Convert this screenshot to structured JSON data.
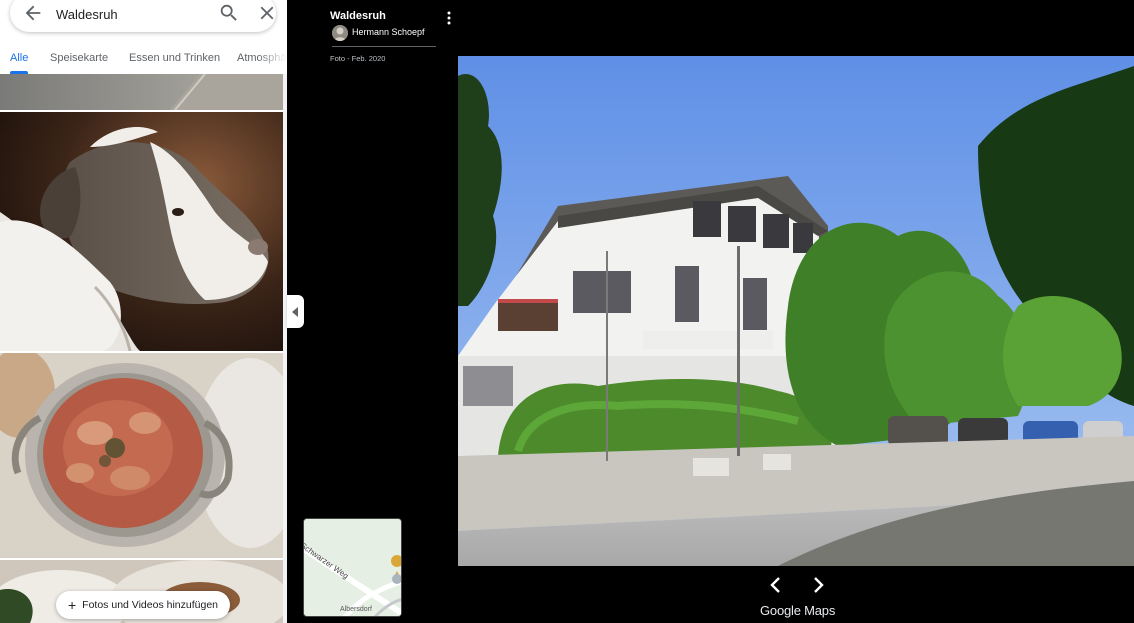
{
  "search": {
    "query": "Waldesruh"
  },
  "tabs": [
    {
      "label": "Alle",
      "active": true
    },
    {
      "label": "Speisekarte",
      "active": false
    },
    {
      "label": "Essen und Trinken",
      "active": false
    },
    {
      "label": "Atmosphäre",
      "active": false
    }
  ],
  "gallery": {
    "add_button_label": "Fotos und Videos hinzufügen"
  },
  "viewer": {
    "place_name": "Waldesruh",
    "author": "Hermann Schoepf",
    "photo_date": "Foto - Feb. 2020",
    "brand": "Google Maps"
  },
  "minimap": {
    "road_label": "Schwarzer Weg",
    "place_label": "Albersdorf"
  },
  "icons": {
    "back": "arrow-left-icon",
    "search": "search-icon",
    "close": "close-icon",
    "more": "more-vert-icon",
    "prev": "chevron-left-icon",
    "next": "chevron-right-icon",
    "collapse": "chevron-left-small-icon",
    "add": "plus-icon"
  },
  "colors": {
    "accent": "#1a73e8",
    "viewer_background": "#000000"
  }
}
